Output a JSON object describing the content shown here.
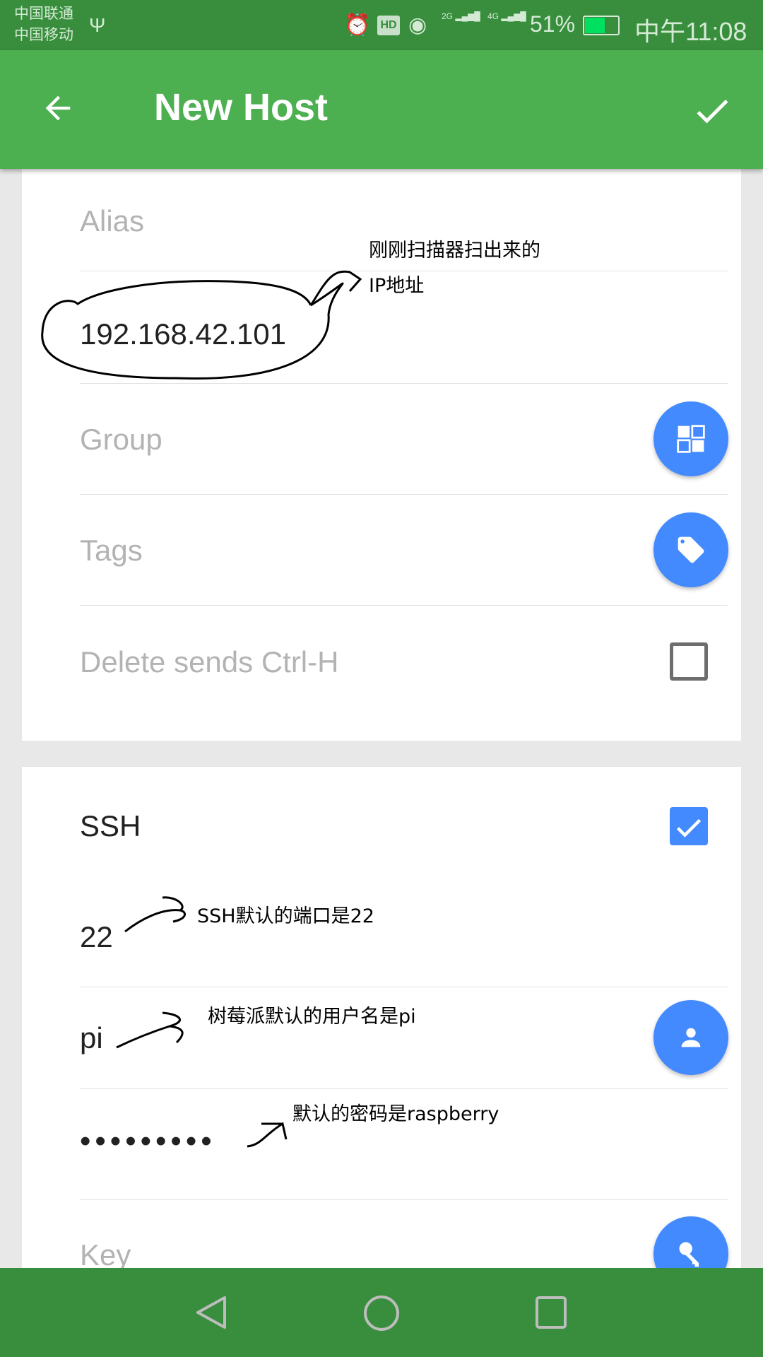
{
  "status_bar": {
    "carrier1": "中国联通",
    "carrier2": "中国移动",
    "battery": "51%",
    "time": "中午11:08",
    "icons": [
      "usb-icon",
      "alarm-icon",
      "hd-icon",
      "eye-icon",
      "signal-2g-icon",
      "signal-4g-icon",
      "battery-charging-icon"
    ]
  },
  "app_bar": {
    "title": "New Host",
    "back_icon": "arrow-left-icon",
    "confirm_icon": "check-icon"
  },
  "colors": {
    "status": "#388e3c",
    "app_bar": "#4caf50",
    "accent": "#448aff"
  },
  "form": {
    "alias_placeholder": "Alias",
    "hostname": "192.168.42.101",
    "group_placeholder": "Group",
    "tags_placeholder": "Tags",
    "delete_ctrl_h_label": "Delete sends Ctrl-H",
    "delete_ctrl_h_checked": false,
    "ssh_label": "SSH",
    "ssh_checked": true,
    "port": "22",
    "username": "pi",
    "password_mask": "•••••••••",
    "key_placeholder": "Key"
  },
  "annotations": {
    "ip_line1": "刚刚扫描器扫出来的",
    "ip_line2": "IP地址",
    "port_note": "SSH默认的端口是22",
    "user_note": "树莓派默认的用户名是pi",
    "password_note": "默认的密码是raspberry"
  }
}
